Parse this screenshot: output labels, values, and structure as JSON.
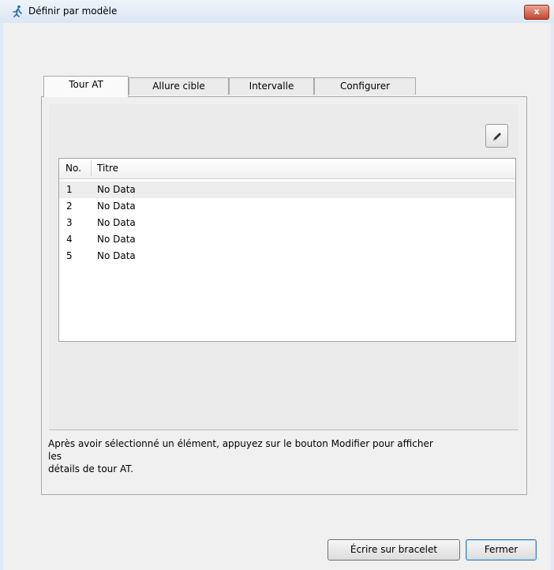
{
  "window": {
    "title": "Définir par modèle",
    "close_label": "x"
  },
  "tabs": [
    {
      "label": "Tour AT",
      "active": true
    },
    {
      "label": "Allure cible",
      "active": false
    },
    {
      "label": "Intervalle",
      "active": false
    },
    {
      "label": "Configurer",
      "active": false
    }
  ],
  "table": {
    "columns": [
      "No.",
      "Titre"
    ],
    "rows": [
      {
        "no": "1",
        "title": "No Data",
        "selected": true
      },
      {
        "no": "2",
        "title": "No Data",
        "selected": false
      },
      {
        "no": "3",
        "title": "No Data",
        "selected": false
      },
      {
        "no": "4",
        "title": "No Data",
        "selected": false
      },
      {
        "no": "5",
        "title": "No Data",
        "selected": false
      }
    ]
  },
  "hint_text": "Après avoir sélectionné un élément, appuyez sur le bouton Modifier pour afficher\nles\ndétails de tour AT.",
  "buttons": {
    "write_label": "Écrire sur bracelet",
    "close_label": "Fermer"
  },
  "icons": {
    "app": "runner-icon",
    "edit": "pencil-icon"
  }
}
